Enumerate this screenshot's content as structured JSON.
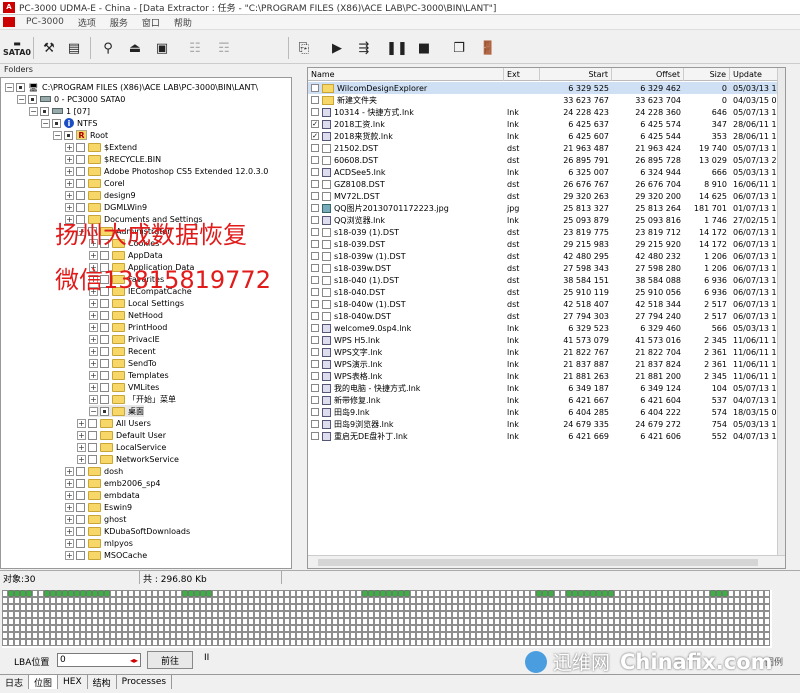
{
  "window": {
    "title": "PC-3000 UDMA-E - China - [Data Extractor : 任务 - \"C:\\PROGRAM FILES (X86)\\ACE LAB\\PC-3000\\BIN\\LANT\"]"
  },
  "menu": [
    "PC-3000",
    "选项",
    "服务",
    "窗口",
    "帮助"
  ],
  "toolbar": {
    "sata_label": "SATA0"
  },
  "folders_header": "Folders",
  "tree": [
    {
      "label": "C:\\PROGRAM FILES (X86)\\ACE LAB\\PC-3000\\BIN\\LANT\\",
      "icon": "computer-icon",
      "indent": 0
    },
    {
      "label": "0 - PC3000 SATA0",
      "icon": "disk-icon",
      "indent": 1
    },
    {
      "label": "1 [07]",
      "icon": "disk-icon",
      "indent": 2
    },
    {
      "label": "NTFS",
      "icon": "info-icon",
      "indent": 3
    },
    {
      "label": "Root",
      "icon": "root-icon",
      "indent": 4
    },
    {
      "label": "$Extend",
      "indent": 5
    },
    {
      "label": "$RECYCLE.BIN",
      "indent": 5
    },
    {
      "label": "Adobe Photoshop CS5 Extended 12.0.3.0",
      "indent": 5
    },
    {
      "label": "Corel",
      "indent": 5
    },
    {
      "label": "design9",
      "indent": 5
    },
    {
      "label": "DGMLWin9",
      "indent": 5
    },
    {
      "label": "Documents and Settings",
      "indent": 5
    },
    {
      "label": "Administrator",
      "indent": 6
    },
    {
      "label": "Cookies",
      "indent": 7
    },
    {
      "label": "AppData",
      "indent": 7
    },
    {
      "label": "Application Data",
      "indent": 7
    },
    {
      "label": "Favorites",
      "indent": 7
    },
    {
      "label": "IECompatCache",
      "indent": 7
    },
    {
      "label": "Local Settings",
      "indent": 7
    },
    {
      "label": "NetHood",
      "indent": 7
    },
    {
      "label": "PrintHood",
      "indent": 7
    },
    {
      "label": "PrivacIE",
      "indent": 7
    },
    {
      "label": "Recent",
      "indent": 7
    },
    {
      "label": "SendTo",
      "indent": 7
    },
    {
      "label": "Templates",
      "indent": 7
    },
    {
      "label": "VMLites",
      "indent": 7
    },
    {
      "label": "「开始」菜单",
      "indent": 7
    },
    {
      "label": "桌面",
      "indent": 7,
      "selected": true
    },
    {
      "label": "All Users",
      "indent": 6
    },
    {
      "label": "Default User",
      "indent": 6
    },
    {
      "label": "LocalService",
      "indent": 6
    },
    {
      "label": "NetworkService",
      "indent": 6
    },
    {
      "label": "dosh",
      "indent": 5
    },
    {
      "label": "emb2006_sp4",
      "indent": 5
    },
    {
      "label": "embdata",
      "indent": 5
    },
    {
      "label": "Eswin9",
      "indent": 5
    },
    {
      "label": "ghost",
      "indent": 5
    },
    {
      "label": "KDubaSoftDownloads",
      "indent": 5
    },
    {
      "label": "mlpyos",
      "indent": 5
    },
    {
      "label": "MSOCache",
      "indent": 5
    }
  ],
  "file_list": {
    "columns": [
      "Name",
      "Ext",
      "Start",
      "Offset",
      "Size",
      "Update"
    ],
    "rows": [
      {
        "name": "WilcomDesignExplorer",
        "ext": "",
        "start": "6 329 525",
        "offset": "6 329 462",
        "size": "0",
        "update": "05/03/13 1...",
        "icon": "folder",
        "checked": false,
        "highlight": true
      },
      {
        "name": "新建文件夹",
        "ext": "",
        "start": "33 623 767",
        "offset": "33 623 704",
        "size": "0",
        "update": "04/03/15 0...",
        "icon": "folder",
        "checked": false
      },
      {
        "name": "10314 - 快捷方式.lnk",
        "ext": "lnk",
        "start": "24 228 423",
        "offset": "24 228 360",
        "size": "646",
        "update": "05/07/13 1...",
        "icon": "lnk",
        "checked": false
      },
      {
        "name": "2018工资.lnk",
        "ext": "lnk",
        "start": "6 425 637",
        "offset": "6 425 574",
        "size": "347",
        "update": "28/06/11 1...",
        "icon": "lnk",
        "checked": true
      },
      {
        "name": "2018来货款.lnk",
        "ext": "lnk",
        "start": "6 425 607",
        "offset": "6 425 544",
        "size": "353",
        "update": "28/06/11 1...",
        "icon": "lnk",
        "checked": true
      },
      {
        "name": "21502.DST",
        "ext": "dst",
        "start": "21 963 487",
        "offset": "21 963 424",
        "size": "19 740",
        "update": "05/07/13 1...",
        "icon": "file",
        "checked": false
      },
      {
        "name": "60608.DST",
        "ext": "dst",
        "start": "26 895 791",
        "offset": "26 895 728",
        "size": "13 029",
        "update": "05/07/13 2...",
        "icon": "file",
        "checked": false
      },
      {
        "name": "ACDSee5.lnk",
        "ext": "lnk",
        "start": "6 325 007",
        "offset": "6 324 944",
        "size": "666",
        "update": "05/03/13 1...",
        "icon": "lnk",
        "checked": false
      },
      {
        "name": "GZ8108.DST",
        "ext": "dst",
        "start": "26 676 767",
        "offset": "26 676 704",
        "size": "8 910",
        "update": "16/06/11 1...",
        "icon": "file",
        "checked": false
      },
      {
        "name": "MV72L.DST",
        "ext": "dst",
        "start": "29 320 263",
        "offset": "29 320 200",
        "size": "14 625",
        "update": "06/07/13 1...",
        "icon": "file",
        "checked": false
      },
      {
        "name": "QQ图片20130701172223.jpg",
        "ext": "jpg",
        "start": "25 813 327",
        "offset": "25 813 264",
        "size": "181 701",
        "update": "01/07/13 1...",
        "icon": "img",
        "checked": false
      },
      {
        "name": "QQ浏览器.lnk",
        "ext": "lnk",
        "start": "25 093 879",
        "offset": "25 093 816",
        "size": "1 746",
        "update": "27/02/15 1...",
        "icon": "lnk",
        "checked": false
      },
      {
        "name": "s18-039 (1).DST",
        "ext": "dst",
        "start": "23 819 775",
        "offset": "23 819 712",
        "size": "14 172",
        "update": "06/07/13 1...",
        "icon": "file",
        "checked": false
      },
      {
        "name": "s18-039.DST",
        "ext": "dst",
        "start": "29 215 983",
        "offset": "29 215 920",
        "size": "14 172",
        "update": "06/07/13 1...",
        "icon": "file",
        "checked": false
      },
      {
        "name": "s18-039w (1).DST",
        "ext": "dst",
        "start": "42 480 295",
        "offset": "42 480 232",
        "size": "1 206",
        "update": "06/07/13 1...",
        "icon": "file",
        "checked": false
      },
      {
        "name": "s18-039w.DST",
        "ext": "dst",
        "start": "27 598 343",
        "offset": "27 598 280",
        "size": "1 206",
        "update": "06/07/13 1...",
        "icon": "file",
        "checked": false
      },
      {
        "name": "s18-040 (1).DST",
        "ext": "dst",
        "start": "38 584 151",
        "offset": "38 584 088",
        "size": "6 936",
        "update": "06/07/13 1...",
        "icon": "file",
        "checked": false
      },
      {
        "name": "s18-040.DST",
        "ext": "dst",
        "start": "25 910 119",
        "offset": "25 910 056",
        "size": "6 936",
        "update": "06/07/13 1...",
        "icon": "file",
        "checked": false
      },
      {
        "name": "s18-040w (1).DST",
        "ext": "dst",
        "start": "42 518 407",
        "offset": "42 518 344",
        "size": "2 517",
        "update": "06/07/13 1...",
        "icon": "file",
        "checked": false
      },
      {
        "name": "s18-040w.DST",
        "ext": "dst",
        "start": "27 794 303",
        "offset": "27 794 240",
        "size": "2 517",
        "update": "06/07/13 1...",
        "icon": "file",
        "checked": false
      },
      {
        "name": "welcome9.0sp4.lnk",
        "ext": "lnk",
        "start": "6 329 523",
        "offset": "6 329 460",
        "size": "566",
        "update": "05/03/13 1...",
        "icon": "lnk",
        "checked": false
      },
      {
        "name": "WPS H5.lnk",
        "ext": "lnk",
        "start": "41 573 079",
        "offset": "41 573 016",
        "size": "2 345",
        "update": "11/06/11 1...",
        "icon": "lnk",
        "checked": false
      },
      {
        "name": "WPS文字.lnk",
        "ext": "lnk",
        "start": "21 822 767",
        "offset": "21 822 704",
        "size": "2 361",
        "update": "11/06/11 1...",
        "icon": "lnk",
        "checked": false
      },
      {
        "name": "WPS演示.lnk",
        "ext": "lnk",
        "start": "21 837 887",
        "offset": "21 837 824",
        "size": "2 361",
        "update": "11/06/11 1...",
        "icon": "lnk",
        "checked": false
      },
      {
        "name": "WPS表格.lnk",
        "ext": "lnk",
        "start": "21 881 263",
        "offset": "21 881 200",
        "size": "2 345",
        "update": "11/06/11 1...",
        "icon": "lnk",
        "checked": false
      },
      {
        "name": "我的电脑 - 快捷方式.lnk",
        "ext": "lnk",
        "start": "6 349 187",
        "offset": "6 349 124",
        "size": "104",
        "update": "05/07/13 1...",
        "icon": "lnk",
        "checked": false
      },
      {
        "name": "新带修复.lnk",
        "ext": "lnk",
        "start": "6 421 667",
        "offset": "6 421 604",
        "size": "537",
        "update": "04/07/13 1...",
        "icon": "lnk",
        "checked": false
      },
      {
        "name": "田岛9.lnk",
        "ext": "lnk",
        "start": "6 404 285",
        "offset": "6 404 222",
        "size": "574",
        "update": "18/03/15 0...",
        "icon": "lnk",
        "checked": false
      },
      {
        "name": "田岛9浏览器.lnk",
        "ext": "lnk",
        "start": "24 679 335",
        "offset": "24 679 272",
        "size": "754",
        "update": "05/03/13 1...",
        "icon": "lnk",
        "checked": false
      },
      {
        "name": "重启无DE盘补丁.lnk",
        "ext": "lnk",
        "start": "6 421 669",
        "offset": "6 421 606",
        "size": "552",
        "update": "04/07/13 1...",
        "icon": "lnk",
        "checked": false
      }
    ]
  },
  "status": {
    "objects": "对象:30",
    "total": "共 : 296.80 Kb"
  },
  "lba": {
    "label": "LBA位置",
    "value": "0",
    "goto_label": "前往",
    "pause_label": "II",
    "legend_label": "图例"
  },
  "tabs": [
    "日志",
    "位图",
    "HEX",
    "结构",
    "Processes"
  ],
  "overlay": {
    "line1": "扬州大成数据恢复",
    "line2": "微信13815819772",
    "site_cn": "迅维网",
    "site_en": "Chinafix.com"
  },
  "colors": {
    "watermark_red": "#e11a1a",
    "map_used": "#3cb043",
    "map_cell": "#ffffff",
    "highlight_row": "#cfe0f5",
    "folder_yellow": "#f7d768"
  }
}
